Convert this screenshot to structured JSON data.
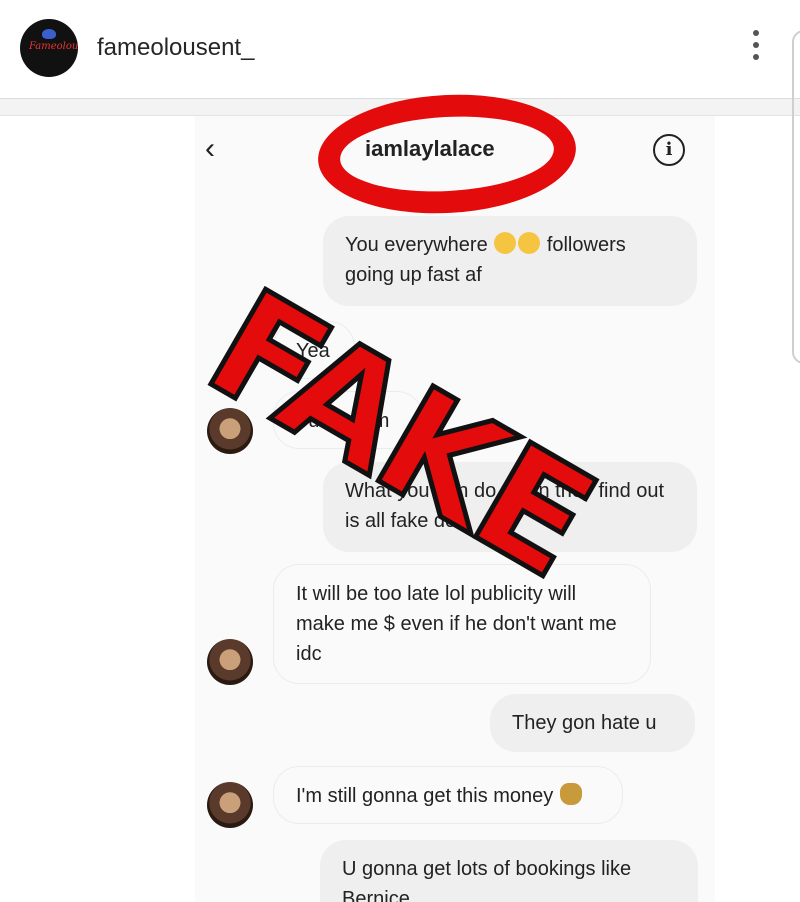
{
  "post": {
    "username": "fameolousent_",
    "avatar_logo_text": "Fameolous"
  },
  "dm": {
    "title": "iamlaylalace",
    "back_glyph": "‹",
    "info_glyph": "i",
    "messages": [
      {
        "text": "You everywhere",
        "after_emoji": "followers going up fast af"
      },
      {
        "text": "Yea"
      },
      {
        "text": "Fuck them"
      },
      {
        "text": "What you gon do when they find out is all fake doe"
      },
      {
        "text": "It will be too late lol publicity will make me $ even if he don't want me idc"
      },
      {
        "text": "They gon hate u"
      },
      {
        "text": "I'm still gonna get this money"
      },
      {
        "text": "U gonna get lots of bookings like Bernice"
      }
    ]
  },
  "overlay": {
    "stamp": "FAKE",
    "color": "#e30b0b"
  },
  "icons": [
    "more-vertical-icon",
    "back-chevron-icon",
    "info-icon",
    "laughing-emoji-icon",
    "money-bag-emoji-icon"
  ]
}
